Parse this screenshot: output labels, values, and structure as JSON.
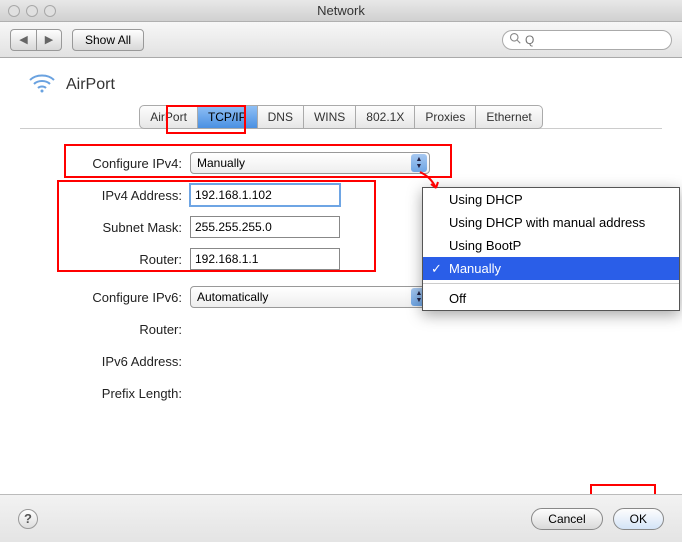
{
  "window": {
    "title": "Network"
  },
  "toolbar": {
    "back_label": "◀",
    "forward_label": "▶",
    "show_all": "Show All",
    "search_placeholder": "Q"
  },
  "interface": {
    "name": "AirPort"
  },
  "tabs": [
    "AirPort",
    "TCP/IP",
    "DNS",
    "WINS",
    "802.1X",
    "Proxies",
    "Ethernet"
  ],
  "active_tab": 1,
  "ipv4": {
    "configure_label": "Configure IPv4:",
    "configure_value": "Manually",
    "address_label": "IPv4 Address:",
    "address_value": "192.168.1.102",
    "subnet_label": "Subnet Mask:",
    "subnet_value": "255.255.255.0",
    "router_label": "Router:",
    "router_value": "192.168.1.1"
  },
  "ipv6": {
    "configure_label": "Configure IPv6:",
    "configure_value": "Automatically",
    "router_label": "Router:",
    "address_label": "IPv6 Address:",
    "prefix_label": "Prefix Length:"
  },
  "menu": {
    "options": [
      "Using DHCP",
      "Using DHCP with manual address",
      "Using BootP",
      "Manually",
      "Off"
    ],
    "selected": 3
  },
  "footer": {
    "help_label": "?",
    "cancel": "Cancel",
    "ok": "OK"
  }
}
